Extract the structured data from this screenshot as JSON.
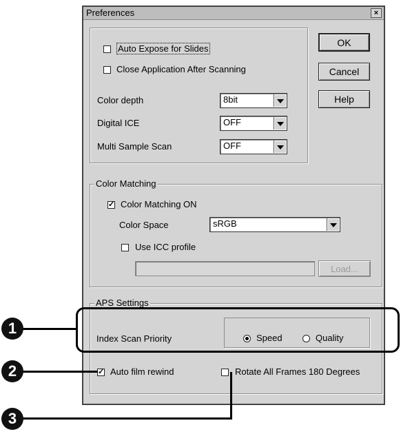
{
  "window": {
    "title": "Preferences",
    "close_glyph": "×"
  },
  "buttons": {
    "ok": "OK",
    "cancel": "Cancel",
    "help": "Help",
    "load": "Load..."
  },
  "general": {
    "auto_expose_label": "Auto Expose for Slides",
    "auto_expose_checked": false,
    "close_app_label": "Close Application After Scanning",
    "close_app_checked": false,
    "color_depth_label": "Color depth",
    "color_depth_value": "8bit",
    "digital_ice_label": "Digital ICE",
    "digital_ice_value": "OFF",
    "multi_sample_label": "Multi Sample Scan",
    "multi_sample_value": "OFF"
  },
  "color_matching": {
    "legend": "Color Matching",
    "on_label": "Color Matching ON",
    "on_checked": true,
    "color_space_label": "Color Space",
    "color_space_value": "sRGB",
    "use_icc_label": "Use ICC profile",
    "use_icc_checked": false,
    "profile_path": ""
  },
  "aps": {
    "legend": "APS Settings",
    "index_scan_label": "Index Scan Priority",
    "speed_label": "Speed",
    "quality_label": "Quality",
    "selected": "Speed",
    "auto_rewind_label": "Auto film rewind",
    "auto_rewind_checked": true,
    "rotate_label": "Rotate All Frames 180 Degrees",
    "rotate_checked": false
  },
  "callouts": {
    "one": "1",
    "two": "2",
    "three": "3"
  },
  "check_glyph": "✓"
}
